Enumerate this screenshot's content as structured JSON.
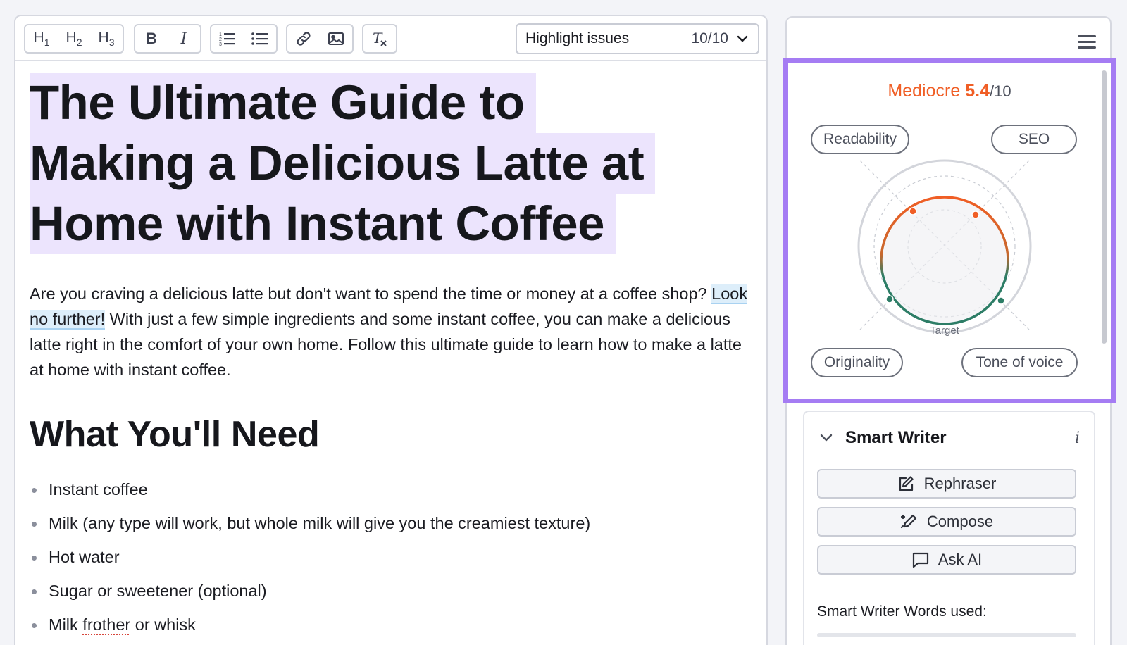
{
  "toolbar": {
    "h1": "H1",
    "h2": "H2",
    "h3": "H3",
    "bold": "B",
    "italic": "I",
    "highlight_label": "Highlight issues",
    "highlight_count": "10/10"
  },
  "article": {
    "title_lines": [
      "The Ultimate Guide to",
      "Making a Delicious Latte at",
      "Home with Instant Coffee"
    ],
    "intro_before": "Are you craving a delicious latte but don't want to spend the time or money at a coffee shop? ",
    "intro_highlight": "Look no further!",
    "intro_after": " With just a few simple ingredients and some instant coffee, you can make a delicious latte right in the comfort of your own home. Follow this ultimate guide to learn how to make a latte at home with instant coffee.",
    "section_heading": "What You'll Need",
    "items": [
      "Instant coffee",
      "Milk (any type will work, but whole milk will give you the creamiest texture)",
      "Hot water",
      "Sugar or sweetener (optional)"
    ],
    "last_item_word": "frother",
    "last_item_before": "Milk ",
    "last_item_after": " or whisk"
  },
  "score": {
    "grade": "Mediocre",
    "value": "5.4",
    "out_of": "/10",
    "target_label": "Target",
    "categories": {
      "readability": "Readability",
      "seo": "SEO",
      "originality": "Originality",
      "tone": "Tone of voice"
    },
    "colors": {
      "accent": "#f05e25",
      "good": "#2d7d66",
      "frame": "#a57cf3"
    }
  },
  "smart_writer": {
    "title": "Smart Writer",
    "info": "i",
    "buttons": {
      "rephraser": "Rephraser",
      "compose": "Compose",
      "ask_ai": "Ask AI"
    },
    "words_used_label": "Smart Writer Words used:"
  }
}
